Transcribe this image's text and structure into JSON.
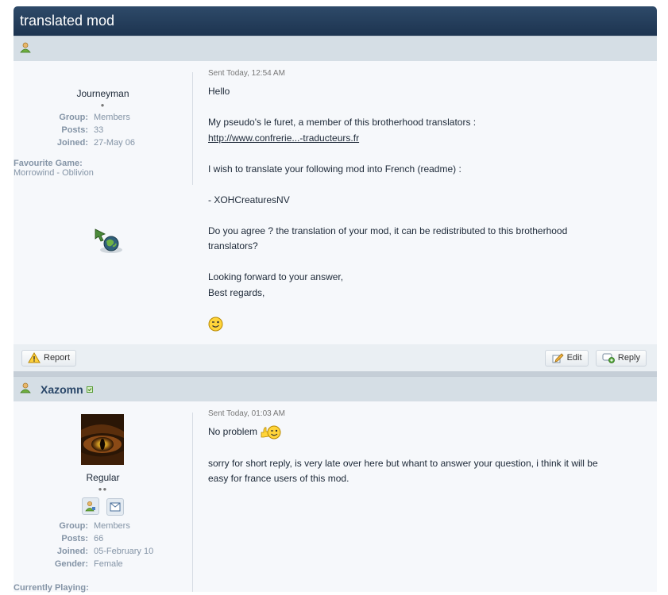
{
  "topic": {
    "title": "translated mod"
  },
  "post1": {
    "sent": "Sent Today, 12:54 AM",
    "rank": "Journeyman",
    "pips": "●",
    "info": [
      {
        "k": "Group:",
        "v": "Members"
      },
      {
        "k": "Posts:",
        "v": "33"
      },
      {
        "k": "Joined:",
        "v": "27-May 06"
      }
    ],
    "fav_label": "Favourite Game:",
    "fav_value": "Morrowind - Oblivion",
    "lines": {
      "l1": "Hello",
      "l2": "My pseudo's le furet, a member of this brotherhood translators :",
      "l3": "http://www.confrerie...-traducteurs.fr",
      "l4": "I wish to translate your following mod into French (readme) :",
      "l5": "- XOHCreaturesNV",
      "l6": "Do you agree ? the translation of your mod, it can be redistributed to this brotherhood",
      "l7": "translators?",
      "l8": "Looking forward to your answer,",
      "l9": "Best regards,"
    },
    "report_label": "Report",
    "edit_label": "Edit",
    "reply_label": "Reply"
  },
  "post2": {
    "author": "Xazomn",
    "sent": "Sent Today, 01:03 AM",
    "rank": "Regular",
    "pips": "●●",
    "info": [
      {
        "k": "Group:",
        "v": "Members"
      },
      {
        "k": "Posts:",
        "v": "66"
      },
      {
        "k": "Joined:",
        "v": "05-February 10"
      },
      {
        "k": "Gender:",
        "v": "Female"
      }
    ],
    "currently_playing": "Currently Playing:",
    "lines": {
      "l1": "No problem",
      "l2": "sorry for short reply, is very late over here but whant to answer your question, i think it will be",
      "l3": "easy for france users of this mod."
    }
  }
}
